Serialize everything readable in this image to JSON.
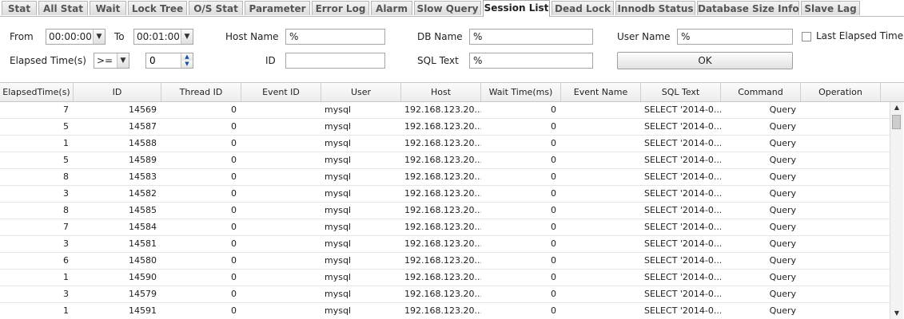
{
  "tabs": [
    {
      "label": "Stat"
    },
    {
      "label": "All Stat"
    },
    {
      "label": "Wait"
    },
    {
      "label": "Lock Tree"
    },
    {
      "label": "O/S Stat"
    },
    {
      "label": "Parameter"
    },
    {
      "label": "Error Log"
    },
    {
      "label": "Alarm"
    },
    {
      "label": "Slow Query"
    },
    {
      "label": "Session List"
    },
    {
      "label": "Dead Lock"
    },
    {
      "label": "Innodb Status"
    },
    {
      "label": "Database Size Info"
    },
    {
      "label": "Slave Lag"
    }
  ],
  "active_tab": "Session List",
  "filter": {
    "from_label": "From",
    "from_value": "00:00:00",
    "to_label": "To",
    "to_value": "00:01:00",
    "elapsed_label": "Elapsed Time(s)",
    "elapsed_op": ">=",
    "elapsed_value": "0",
    "host_label": "Host Name",
    "host_value": "%",
    "id_label": "ID",
    "id_value": "",
    "db_label": "DB Name",
    "db_value": "%",
    "sql_label": "SQL Text",
    "sql_value": "%",
    "user_label": "User Name",
    "user_value": "%",
    "last_elapsed_label": "Last Elapsed Time",
    "ok_label": "OK"
  },
  "columns": [
    "ElapsedTime(s)",
    "ID",
    "Thread ID",
    "Event ID",
    "User",
    "Host",
    "Wait Time(ms)",
    "Event Name",
    "SQL Text",
    "Command",
    "Operation"
  ],
  "rows": [
    {
      "elapsed": "7",
      "id": "14569",
      "thread": "0",
      "event_id": "",
      "user": "mysql",
      "host": "192.168.123.20...",
      "wait": "0",
      "event_name": "",
      "sql": "SELECT '2014-0...",
      "command": "Query",
      "operation": ""
    },
    {
      "elapsed": "5",
      "id": "14587",
      "thread": "0",
      "event_id": "",
      "user": "mysql",
      "host": "192.168.123.20...",
      "wait": "0",
      "event_name": "",
      "sql": "SELECT '2014-0...",
      "command": "Query",
      "operation": ""
    },
    {
      "elapsed": "1",
      "id": "14588",
      "thread": "0",
      "event_id": "",
      "user": "mysql",
      "host": "192.168.123.20...",
      "wait": "0",
      "event_name": "",
      "sql": "SELECT '2014-0...",
      "command": "Query",
      "operation": ""
    },
    {
      "elapsed": "5",
      "id": "14589",
      "thread": "0",
      "event_id": "",
      "user": "mysql",
      "host": "192.168.123.20...",
      "wait": "0",
      "event_name": "",
      "sql": "SELECT '2014-0...",
      "command": "Query",
      "operation": ""
    },
    {
      "elapsed": "8",
      "id": "14583",
      "thread": "0",
      "event_id": "",
      "user": "mysql",
      "host": "192.168.123.20...",
      "wait": "0",
      "event_name": "",
      "sql": "SELECT '2014-0...",
      "command": "Query",
      "operation": ""
    },
    {
      "elapsed": "3",
      "id": "14582",
      "thread": "0",
      "event_id": "",
      "user": "mysql",
      "host": "192.168.123.20...",
      "wait": "0",
      "event_name": "",
      "sql": "SELECT '2014-0...",
      "command": "Query",
      "operation": ""
    },
    {
      "elapsed": "8",
      "id": "14585",
      "thread": "0",
      "event_id": "",
      "user": "mysql",
      "host": "192.168.123.20...",
      "wait": "0",
      "event_name": "",
      "sql": "SELECT '2014-0...",
      "command": "Query",
      "operation": ""
    },
    {
      "elapsed": "7",
      "id": "14584",
      "thread": "0",
      "event_id": "",
      "user": "mysql",
      "host": "192.168.123.20...",
      "wait": "0",
      "event_name": "",
      "sql": "SELECT '2014-0...",
      "command": "Query",
      "operation": ""
    },
    {
      "elapsed": "3",
      "id": "14581",
      "thread": "0",
      "event_id": "",
      "user": "mysql",
      "host": "192.168.123.20...",
      "wait": "0",
      "event_name": "",
      "sql": "SELECT '2014-0...",
      "command": "Query",
      "operation": ""
    },
    {
      "elapsed": "6",
      "id": "14580",
      "thread": "0",
      "event_id": "",
      "user": "mysql",
      "host": "192.168.123.20...",
      "wait": "0",
      "event_name": "",
      "sql": "SELECT '2014-0...",
      "command": "Query",
      "operation": ""
    },
    {
      "elapsed": "1",
      "id": "14590",
      "thread": "0",
      "event_id": "",
      "user": "mysql",
      "host": "192.168.123.20...",
      "wait": "0",
      "event_name": "",
      "sql": "SELECT '2014-0...",
      "command": "Query",
      "operation": ""
    },
    {
      "elapsed": "3",
      "id": "14579",
      "thread": "0",
      "event_id": "",
      "user": "mysql",
      "host": "192.168.123.20...",
      "wait": "0",
      "event_name": "",
      "sql": "SELECT '2014-0...",
      "command": "Query",
      "operation": ""
    },
    {
      "elapsed": "1",
      "id": "14591",
      "thread": "0",
      "event_id": "",
      "user": "mysql",
      "host": "192.168.123.20...",
      "wait": "0",
      "event_name": "",
      "sql": "SELECT '2014-0...",
      "command": "Query",
      "operation": ""
    }
  ],
  "colors": {
    "header_bg": "#ececec",
    "border": "#c8c8c8",
    "tab_active": "#ffffff",
    "text": "#222222"
  }
}
